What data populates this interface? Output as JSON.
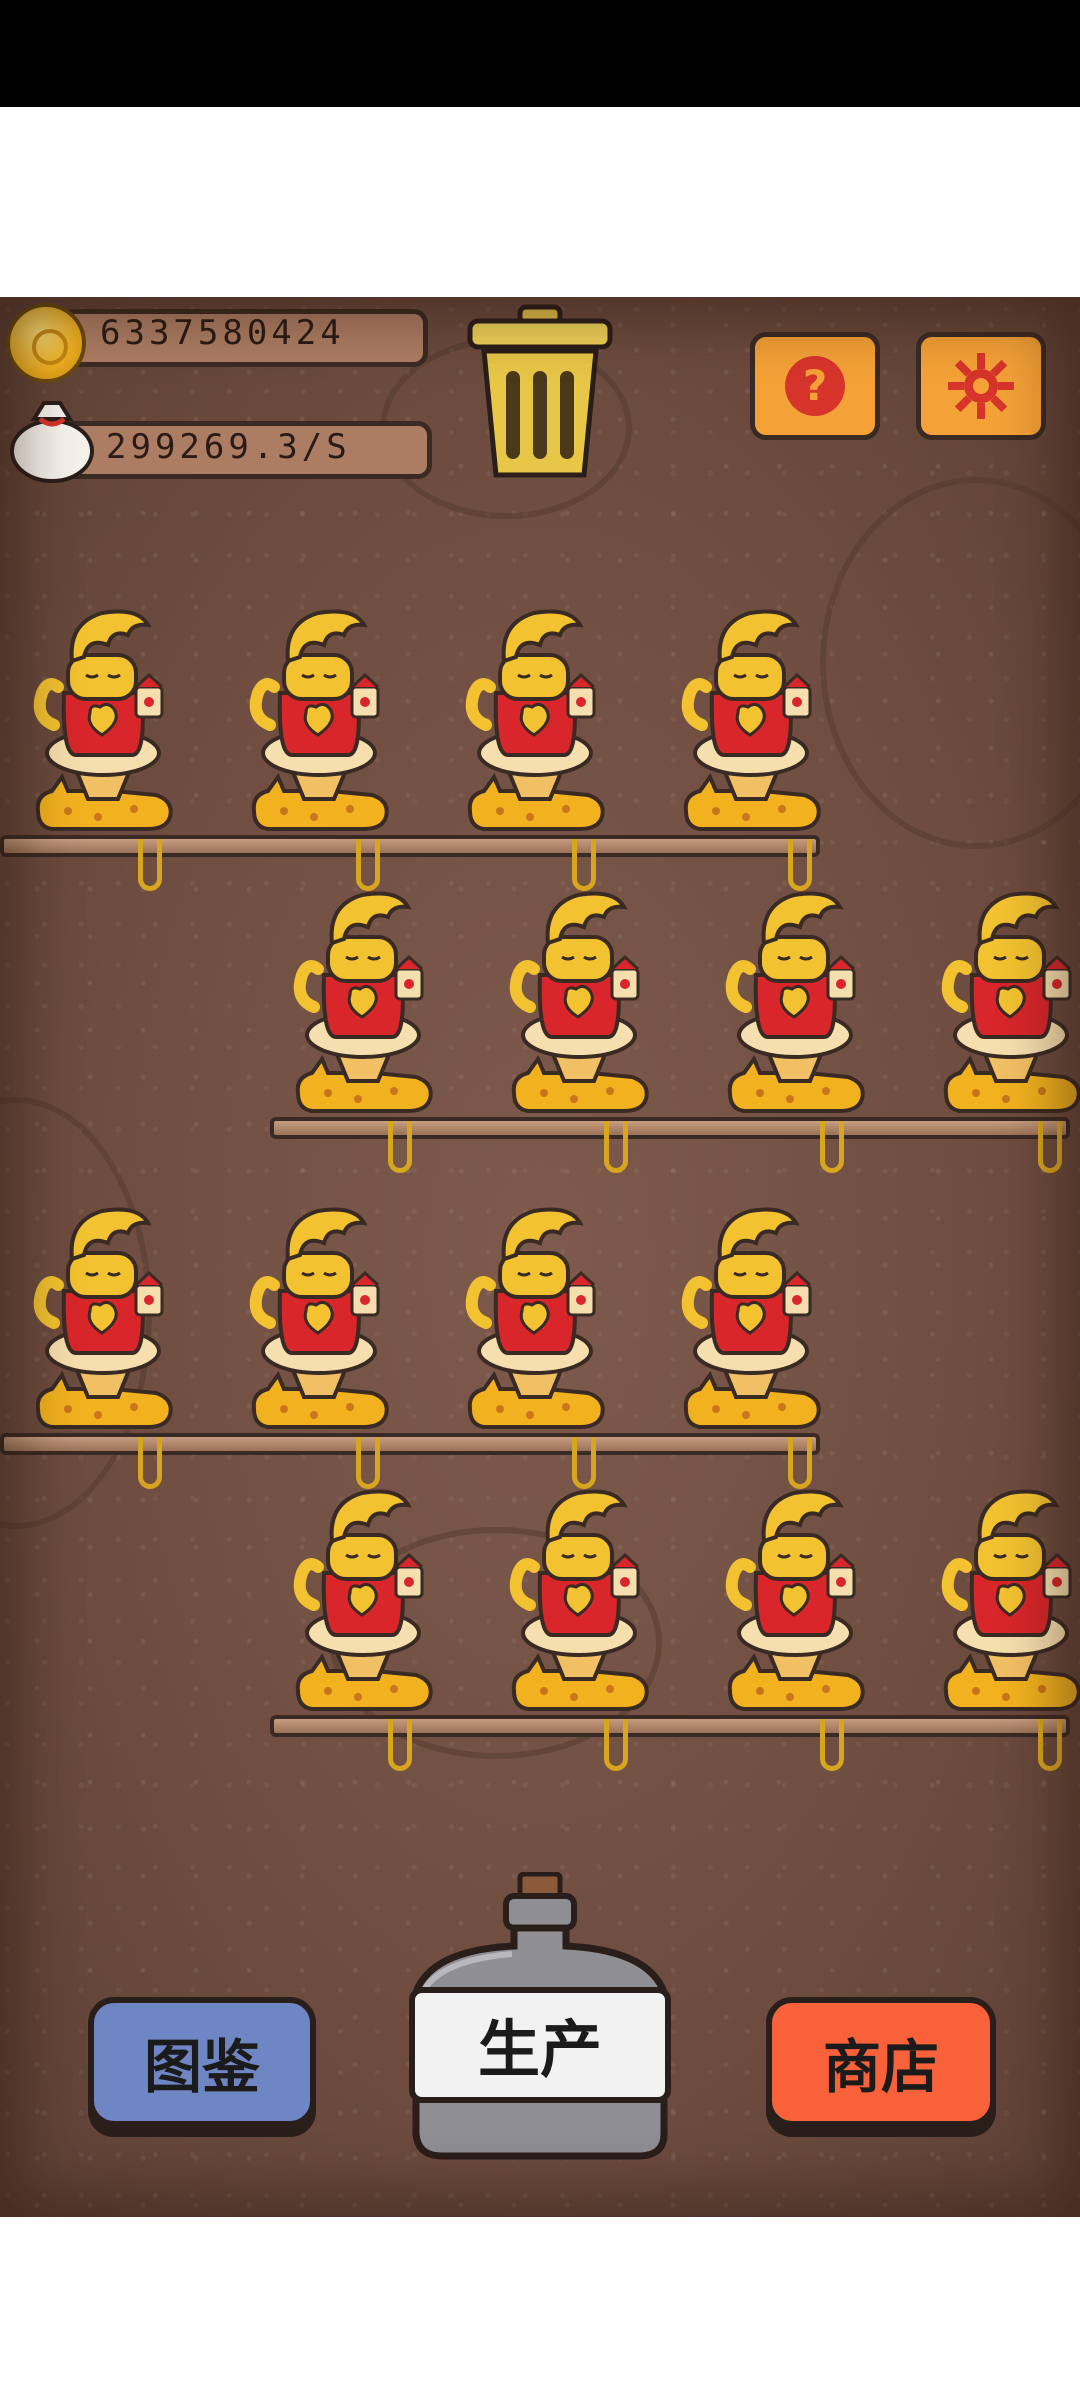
{
  "hud": {
    "coins": "6337580424",
    "rate": "299269.3/S"
  },
  "icons": {
    "coin": "gold-coin-icon",
    "bag": "money-bag-icon",
    "trash": "trash-can-icon",
    "help": "question-mark-icon",
    "settings": "gear-icon"
  },
  "buttons": {
    "collection": "图鉴",
    "produce": "生产",
    "shop": "商店"
  },
  "colors": {
    "background": "#6e4d40",
    "help_button": "#f4a137",
    "collection_button": "#6f86c4",
    "shop_button": "#f8613a",
    "bottle": "#8e8e93",
    "cat_robe": "#d8262a",
    "cat_gold": "#f2c230"
  },
  "shelves": [
    {
      "cats": 4
    },
    {
      "cats": 4
    },
    {
      "cats": 4
    },
    {
      "cats": 4
    }
  ]
}
